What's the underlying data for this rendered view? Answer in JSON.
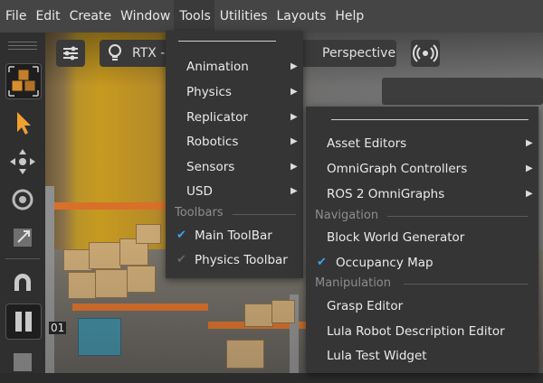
{
  "menubar": {
    "items": [
      "File",
      "Edit",
      "Create",
      "Window",
      "Tools",
      "Utilities",
      "Layouts",
      "Help"
    ]
  },
  "viewport_toolbar": {
    "renderer_label": "RTX -",
    "camera_label": "Perspective",
    "icons": [
      "settings-sliders-icon",
      "lightbulb-icon",
      "camera-icon",
      "broadcast-icon"
    ]
  },
  "tools_menu": {
    "items": [
      {
        "label": "Animation",
        "submenu": true
      },
      {
        "label": "Physics",
        "submenu": true
      },
      {
        "label": "Replicator",
        "submenu": true
      },
      {
        "label": "Robotics",
        "submenu": true
      },
      {
        "label": "Sensors",
        "submenu": true
      },
      {
        "label": "USD",
        "submenu": true
      }
    ],
    "toolbars_section": "Toolbars",
    "toolbar_items": [
      {
        "label": "Main ToolBar",
        "checked": true
      },
      {
        "label": "Physics Toolbar",
        "checked": true,
        "dimmed_check": true
      }
    ]
  },
  "robotics_submenu": {
    "items": [
      {
        "label": "Asset Editors",
        "submenu": true
      },
      {
        "label": "OmniGraph Controllers",
        "submenu": true
      },
      {
        "label": "ROS 2 OmniGraphs",
        "submenu": true
      }
    ],
    "navigation_section": "Navigation",
    "navigation_items": [
      {
        "label": "Block World Generator",
        "checked": false
      },
      {
        "label": "Occupancy Map",
        "checked": true
      }
    ],
    "manipulation_section": "Manipulation",
    "manipulation_items": [
      {
        "label": "Grasp Editor"
      },
      {
        "label": "Lula Robot Description Editor"
      },
      {
        "label": "Lula Test Widget"
      }
    ]
  },
  "viewport_scene": {
    "shelf_label_fragment": "01"
  },
  "colors": {
    "accent_check": "#3aa6e8",
    "menu_bg": "#353535",
    "menubar_bg": "#454545",
    "select_arrow": "#f0a030"
  }
}
